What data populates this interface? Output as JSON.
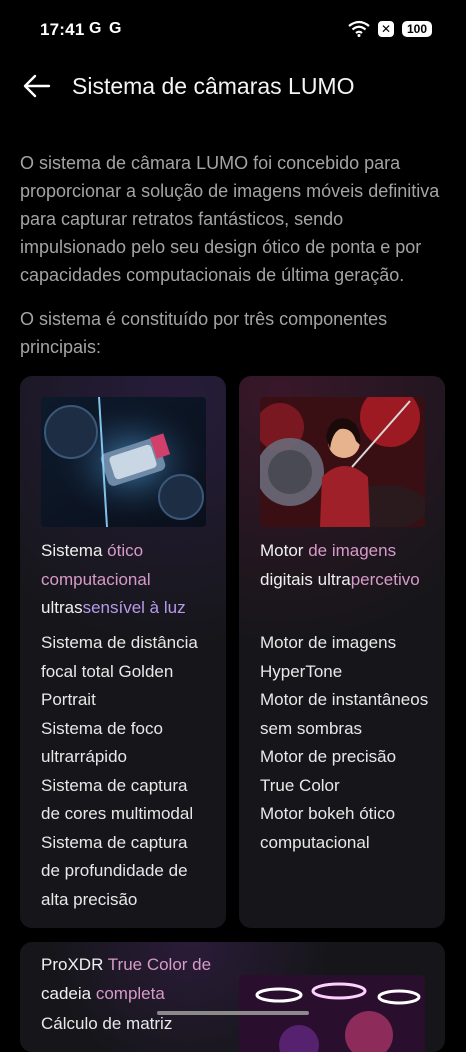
{
  "status": {
    "time": "17:41",
    "g1": "G",
    "g2": "G",
    "battery": "100"
  },
  "appbar": {
    "title": "Sistema de câmaras LUMO"
  },
  "intro": "O sistema de câmara LUMO foi concebido para proporcionar a solução de imagens móveis definitiva para capturar retratos fantásticos, sendo impulsionado pelo seu design ótico de ponta e por capacidades computacionais de última geração.",
  "intro2": "O sistema é constituído por três componentes principais:",
  "cards": [
    {
      "title_parts": [
        "Sistema",
        " ótico computacional",
        " ultras",
        "sensível à luz"
      ],
      "items": [
        "Sistema de distância focal total Golden Portrait",
        "Sistema de foco ultrarrápido",
        "Sistema de captura de cores multimodal",
        "Sistema de captura de profundidade de alta precisão"
      ]
    },
    {
      "title_parts": [
        "Motor",
        " de imagens",
        " digitais ultra",
        "percetivo"
      ],
      "items": [
        "Motor de imagens HyperTone",
        "Motor de instantâneos sem sombras",
        "Motor de precisão True Color",
        "Motor bokeh ótico computacional"
      ]
    }
  ],
  "bottom_card": {
    "title_parts": [
      "ProXDR",
      " True Color de",
      " cadeia",
      " completa"
    ],
    "text": "Cálculo de matriz"
  }
}
